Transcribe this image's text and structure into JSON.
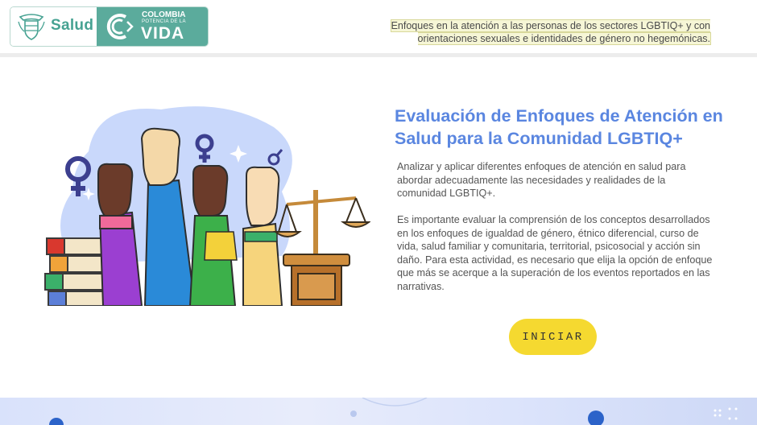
{
  "header": {
    "logo_salud": "Salud",
    "logo_colombia": "COLOMBIA",
    "logo_potencia": "POTENCIA DE LA",
    "logo_vida": "VIDA",
    "title": "Enfoques en la atención a las personas de los sectores LGBTIQ+ y con orientaciones sexuales e identidades de género no hegemónicas."
  },
  "main": {
    "title": "Evaluación de Enfoques de Atención en Salud para la Comunidad LGBTIQ+",
    "paragraph1": "Analizar y aplicar diferentes enfoques de atención en salud para abordar adecuadamente las necesidades y realidades de la comunidad LGBTIQ+.",
    "paragraph2": "Es importante evaluar la comprensión de los conceptos desarrollados en los enfoques de igualdad de género, étnico diferencial, curso de vida, salud familiar y comunitaria, territorial, psicosocial y acción sin daño. Para esta actividad, es necesario que elija la opción de enfoque que más se acerque a la superación de los eventos reportados en las narrativas.",
    "start_button": "INICIAR"
  },
  "colors": {
    "accent_title": "#5a86e0",
    "button": "#f5d930",
    "logo_green": "#5bab9c"
  },
  "icons": [
    "coat-of-arms-icon",
    "colombia-c-icon",
    "female-symbol-icon",
    "male-symbol-icon",
    "scales-of-justice-icon"
  ]
}
